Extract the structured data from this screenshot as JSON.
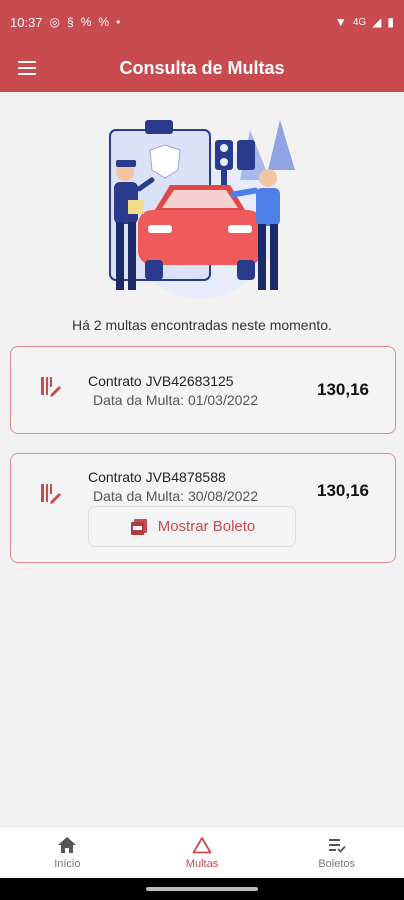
{
  "status_bar": {
    "time": "10:37",
    "left_icons": [
      "whatsapp-icon",
      "storage-icon",
      "percent-icon",
      "percent-icon",
      "dot-icon"
    ],
    "right_icons": [
      "wifi-icon",
      "signal-4g-icon",
      "signal-icon",
      "battery-icon"
    ],
    "network_label": "4G"
  },
  "app_bar": {
    "title": "Consulta de Multas",
    "menu_icon": "hamburger-menu-icon"
  },
  "summary_text": "Há 2 multas encontradas neste momento.",
  "fines": [
    {
      "contract": "Contrato JVB42683125",
      "date": "Data da Multa: 01/03/2022",
      "amount": "130,16"
    },
    {
      "contract": "Contrato JVB4878588",
      "date": "Data da Multa: 30/08/2022",
      "amount": "130,16",
      "button_label": "Mostrar Boleto"
    }
  ],
  "bottom_nav": [
    {
      "label": "Início",
      "icon": "home-icon",
      "active": false
    },
    {
      "label": "Multas",
      "icon": "warning-triangle-icon",
      "active": true
    },
    {
      "label": "Boletos",
      "icon": "checklist-icon",
      "active": false
    }
  ],
  "colors": {
    "primary": "#c84b4f",
    "card_border": "#e08a8c",
    "background": "#f2f2f2"
  }
}
